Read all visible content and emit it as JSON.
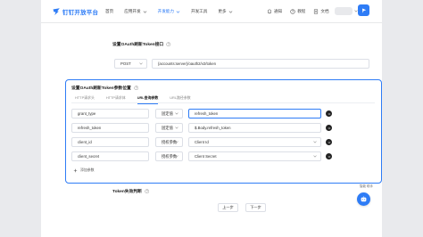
{
  "header": {
    "logo_text": "钉钉开放平台",
    "nav": [
      {
        "label": "首页",
        "has_menu": false,
        "active": false
      },
      {
        "label": "应用开发",
        "has_menu": true,
        "active": false
      },
      {
        "label": "开发能力",
        "has_menu": true,
        "active": true
      },
      {
        "label": "开发工具",
        "has_menu": false,
        "active": false
      },
      {
        "label": "更多",
        "has_menu": true,
        "active": false
      }
    ],
    "notify_label": "通知",
    "help_label": "教程",
    "docs_label": "文档"
  },
  "interface_section": {
    "title": "设置OAuth刷新Token接口",
    "method": "POST",
    "url": "{accounts:server}/oauth2/v2/token"
  },
  "param_panel": {
    "title": "设置OAuth刷新Token参数位置",
    "tabs": [
      {
        "label": "HTTP请求头",
        "active": false
      },
      {
        "label": "HTTP请求体",
        "active": false
      },
      {
        "label": "URL查询参数",
        "active": true
      },
      {
        "label": "URL路径参数",
        "active": false
      }
    ],
    "rows": [
      {
        "name": "grant_type",
        "type": "固定值",
        "value": "refresh_token",
        "value_is_select": false,
        "focused": true
      },
      {
        "name": "refresh_token",
        "type": "固定值",
        "value": "$.Body.refresh_token",
        "value_is_select": false,
        "focused": false
      },
      {
        "name": "client_id",
        "type": "授权参数",
        "value": "Client Id",
        "value_is_select": true,
        "focused": false
      },
      {
        "name": "client_secret",
        "type": "授权参数",
        "value": "Client Secret",
        "value_is_select": true,
        "focused": false
      }
    ],
    "add_label": "添加参数"
  },
  "failure_section": {
    "title": "Token失效判断"
  },
  "footer": {
    "prev_label": "上一步",
    "next_label": "下一步"
  },
  "float_assistant": {
    "label": "智能\n助手"
  },
  "colors": {
    "brand": "#2e7cf6",
    "border": "#dcdfe6"
  }
}
